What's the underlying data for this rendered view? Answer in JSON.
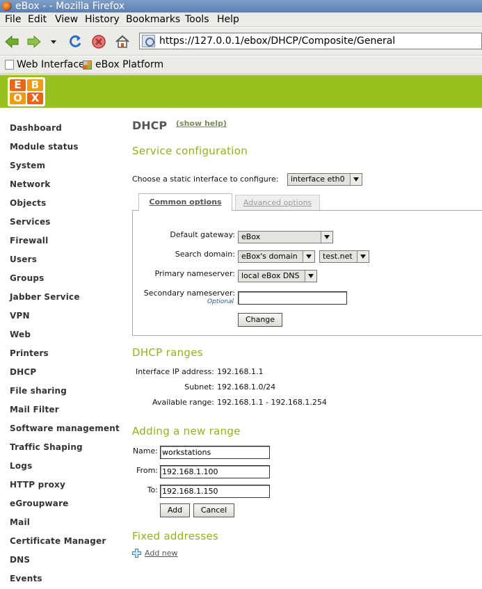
{
  "window": {
    "title": "eBox - - Mozilla Firefox"
  },
  "menubar": {
    "items": [
      "File",
      "Edit",
      "View",
      "History",
      "Bookmarks",
      "Tools",
      "Help"
    ]
  },
  "browser": {
    "url": "https://127.0.0.1/ebox/DHCP/Composite/General"
  },
  "bookmarks": {
    "items": [
      "Web Interface",
      "eBox Platform"
    ]
  },
  "logo": {
    "letters": [
      "E",
      "B",
      "O",
      "X"
    ]
  },
  "sidebar": {
    "items": [
      "Dashboard",
      "Module status",
      "System",
      "Network",
      "Objects",
      "Services",
      "Firewall",
      "Users",
      "Groups",
      "Jabber Service",
      "VPN",
      "Web",
      "Printers",
      "DHCP",
      "File sharing",
      "Mail Filter",
      "Software management",
      "Traffic Shaping",
      "Logs",
      "HTTP proxy",
      "eGroupware",
      "Mail",
      "Certificate Manager",
      "DNS",
      "Events"
    ]
  },
  "page": {
    "title": "DHCP",
    "show_help": "(show help)"
  },
  "service": {
    "heading": "Service configuration",
    "choose_label": "Choose a static interface to configure:",
    "interface_value": "interface eth0",
    "tabs": {
      "common": "Common options",
      "advanced": "Advanced options"
    },
    "gateway_label": "Default gateway:",
    "gateway_value": "eBox",
    "search_label": "Search domain:",
    "search_value": "eBox's domain",
    "search_domain": "test.net",
    "primary_label": "Primary nameserver:",
    "primary_value": "local eBox DNS",
    "secondary_label": "Secondary nameserver:",
    "optional": "Optional",
    "secondary_value": "",
    "change_button": "Change"
  },
  "ranges": {
    "heading": "DHCP ranges",
    "ip_label": "Interface IP address:",
    "ip_value": "192.168.1.1",
    "subnet_label": "Subnet:",
    "subnet_value": "192.168.1.0/24",
    "available_label": "Available range:",
    "available_value": "192.168.1.1 - 192.168.1.254"
  },
  "newrange": {
    "heading": "Adding a new range",
    "name_label": "Name:",
    "name_value": "workstations",
    "from_label": "From:",
    "from_value": "192.168.1.100",
    "to_label": "To:",
    "to_value": "192.168.1.150",
    "add_button": "Add",
    "cancel_button": "Cancel"
  },
  "fixed": {
    "heading": "Fixed addresses",
    "add_new": "Add new"
  },
  "colors": {
    "brand_green": "#96c11e",
    "heading_green": "#8eb31a",
    "logo_orange": "#e86618"
  }
}
